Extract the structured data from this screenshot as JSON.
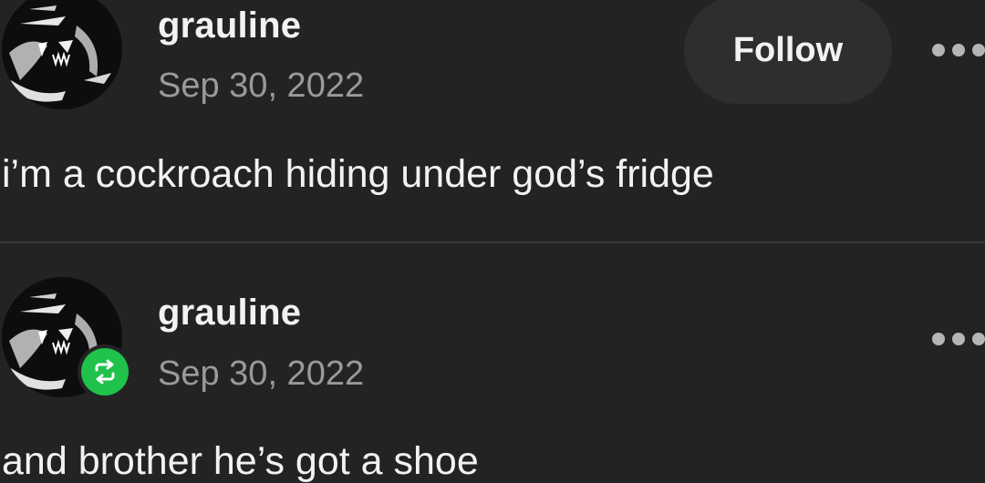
{
  "posts": [
    {
      "username": "grauline",
      "date": "Sep 30, 2022",
      "follow_label": "Follow",
      "text": "i’m a cockroach hiding under god’s fridge"
    },
    {
      "username": "grauline",
      "date": "Sep 30, 2022",
      "text": "and brother he’s got a shoe",
      "reblog_icon": "reblog-icon"
    }
  ],
  "colors": {
    "background": "#232323",
    "reblog_badge": "#1fc24a",
    "date_text": "#9a9a9a",
    "follow_button_bg": "#2e2e2e"
  },
  "icons": {
    "more": "more-horizontal-icon",
    "reblog": "reblog-icon"
  }
}
